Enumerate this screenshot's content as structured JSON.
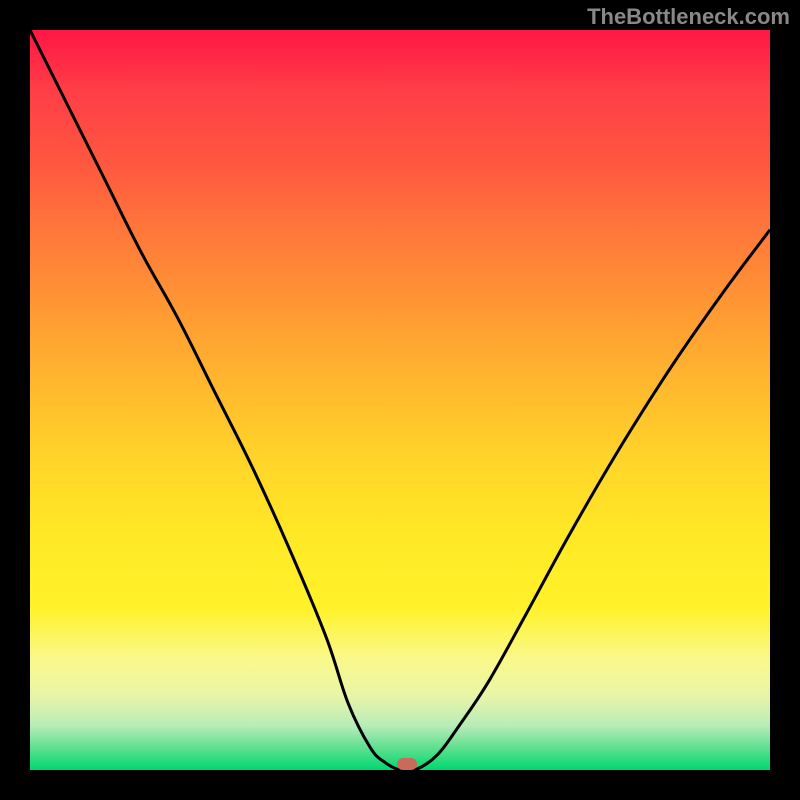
{
  "watermark": "TheBottleneck.com",
  "chart_data": {
    "type": "line",
    "title": "",
    "xlabel": "",
    "ylabel": "",
    "xlim": [
      0,
      100
    ],
    "ylim": [
      0,
      100
    ],
    "series": [
      {
        "name": "curve",
        "x": [
          0,
          5,
          10,
          15,
          20,
          25,
          30,
          35,
          40,
          43,
          46,
          48,
          50,
          52,
          55,
          58,
          62,
          67,
          73,
          80,
          87,
          94,
          100
        ],
        "y": [
          100,
          90,
          80,
          70,
          61,
          51,
          41,
          30,
          18,
          9,
          3,
          1,
          0,
          0,
          2,
          6,
          12,
          21,
          32,
          44,
          55,
          65,
          73
        ]
      }
    ],
    "marker": {
      "x": 51,
      "y": 0,
      "color": "#c96a5a"
    },
    "gradient_colors": {
      "top": "#ff1744",
      "mid1": "#ff9933",
      "mid2": "#ffe826",
      "bottom": "#00d870"
    }
  }
}
